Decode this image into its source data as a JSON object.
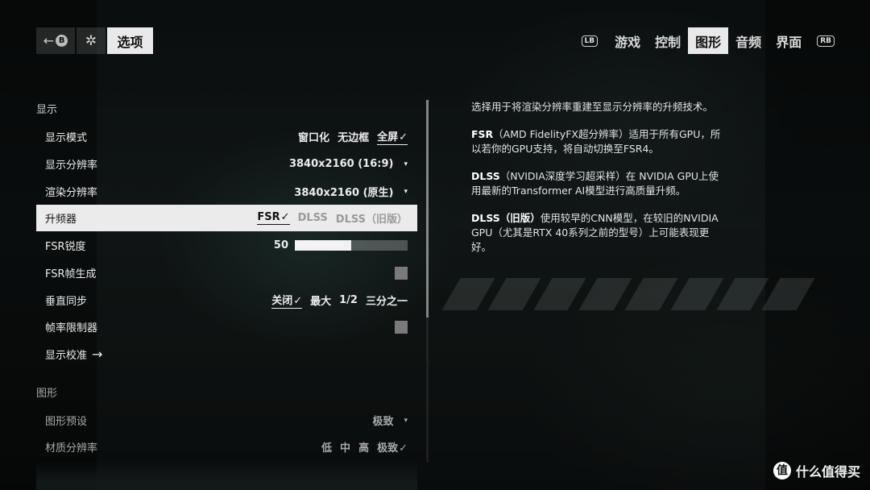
{
  "topbar": {
    "back_label": "←",
    "back_button_glyph": "B",
    "settings_icon": "gear-icon",
    "title": "选项"
  },
  "tabs": {
    "lb": "LB",
    "rb": "RB",
    "items": [
      {
        "label": "游戏",
        "active": false
      },
      {
        "label": "控制",
        "active": false
      },
      {
        "label": "图形",
        "active": true
      },
      {
        "label": "音频",
        "active": false
      },
      {
        "label": "界面",
        "active": false
      }
    ]
  },
  "display": {
    "section_title": "显示",
    "display_mode": {
      "label": "显示模式",
      "options": [
        "窗口化",
        "无边框",
        "全屏"
      ],
      "selected": "全屏"
    },
    "display_resolution": {
      "label": "显示分辨率",
      "value": "3840x2160 (16:9)"
    },
    "render_resolution": {
      "label": "渲染分辨率",
      "value": "3840x2160 (原生)"
    },
    "upscaler": {
      "label": "升频器",
      "options": [
        "FSR",
        "DLSS",
        "DLSS（旧版）"
      ],
      "selected": "FSR"
    },
    "fsr_sharpness": {
      "label": "FSR锐度",
      "value": "50",
      "level": 0.5
    },
    "fsr_frame_gen": {
      "label": "FSR帧生成",
      "checked": false
    },
    "vsync": {
      "label": "垂直同步",
      "options": [
        "关闭",
        "最大",
        "1/2",
        "三分之一"
      ],
      "selected": "关闭"
    },
    "frame_limiter": {
      "label": "帧率限制器",
      "checked": false
    },
    "calibration": {
      "label": "显示校准",
      "arrow": "→"
    }
  },
  "graphics": {
    "section_title": "图形",
    "preset": {
      "label": "图形预设",
      "value": "极致"
    },
    "texture_resolution": {
      "label": "材质分辨率",
      "options": [
        "低",
        "中",
        "高",
        "极致"
      ],
      "selected": "极致"
    }
  },
  "description": {
    "intro": "选择用于将渲染分辨率重建至显示分辨率的升频技术。",
    "fsr_title": "FSR",
    "fsr_text": "（AMD FidelityFX超分辨率）适用于所有GPU，所以若你的GPU支持，将自动切换至FSR4。",
    "dlss_title": "DLSS",
    "dlss_text": "（NVIDIA深度学习超采样）在 NVIDIA GPU上使用最新的Transformer AI模型进行高质量升频。",
    "dlss_legacy_title": "DLSS（旧版）",
    "dlss_legacy_text": "使用较早的CNN模型，在较旧的NVIDIA GPU（尤其是RTX 40系列之前的型号）上可能表现更好。"
  },
  "watermark": {
    "logo_glyph": "值",
    "text": "什么值得买"
  },
  "colors": {
    "highlight_bg": "#ebebeb",
    "active_tab_bg": "#e9e9e9"
  }
}
